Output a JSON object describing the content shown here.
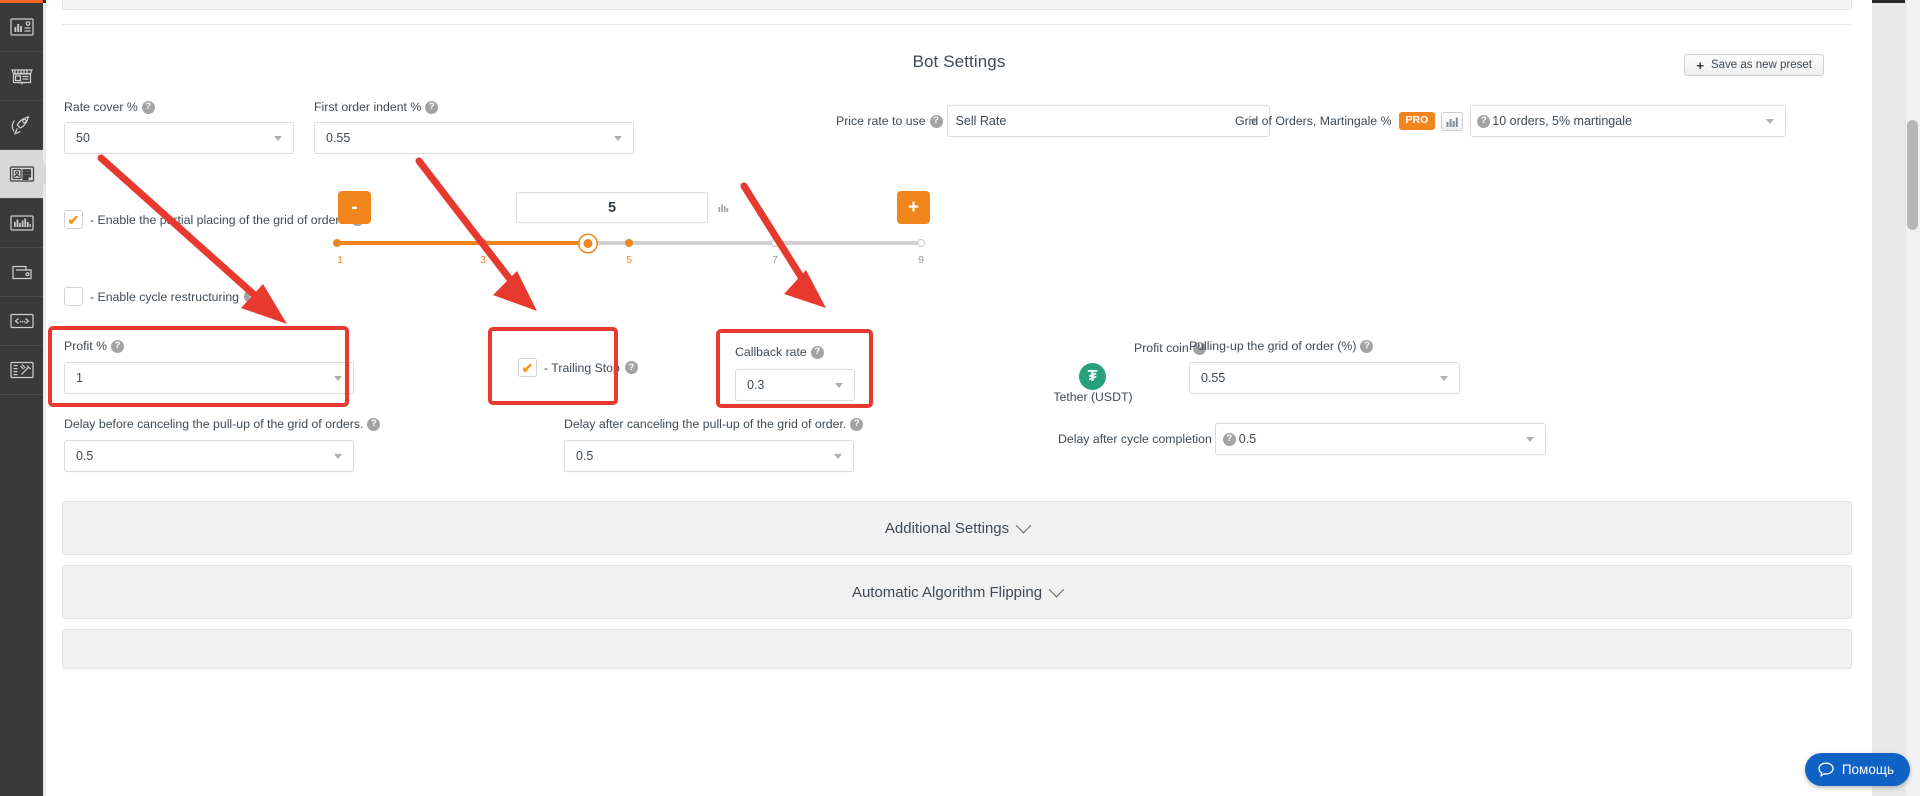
{
  "sidebar": {
    "items": [
      {
        "name": "dashboard",
        "icon": "chart-report-icon",
        "active": false
      },
      {
        "name": "marketplace",
        "icon": "storefront-icon",
        "active": false
      },
      {
        "name": "launch",
        "icon": "rocket-icon",
        "active": false
      },
      {
        "name": "bots",
        "icon": "id-card-icon",
        "active": true
      },
      {
        "name": "statistics",
        "icon": "bar-chart-icon",
        "active": false
      },
      {
        "name": "wallet",
        "icon": "wallet-icon",
        "active": false
      },
      {
        "name": "api",
        "icon": "code-brackets-icon",
        "active": false
      },
      {
        "name": "tools",
        "icon": "list-tools-icon",
        "active": false
      }
    ]
  },
  "header": {
    "title": "Bot Settings",
    "save_preset_label": "Save as new preset",
    "save_preset_plus": "+"
  },
  "fields": {
    "rate_cover": {
      "label": "Rate cover %",
      "value": "50",
      "help": "?"
    },
    "first_order_indent": {
      "label": "First order indent %",
      "value": "0.55",
      "help": "?"
    },
    "price_rate_to_use": {
      "label": "Price rate to use",
      "value": "Sell Rate",
      "help": "?"
    },
    "grid_martingale": {
      "label": "Grid of Orders, Martingale %",
      "badge": "PRO",
      "chart_icon": "bar-chart-icon",
      "help": "?",
      "value": "10 orders, 5% martingale"
    },
    "profit_pct": {
      "label": "Profit %",
      "value": "1",
      "help": "?"
    },
    "callback_rate": {
      "label": "Callback rate",
      "value": "0.3",
      "help": "?"
    },
    "profit_coin": {
      "label": "Profit coin",
      "help": "?",
      "coin_symbol": "₮",
      "coin_name": "Tether (USDT)"
    },
    "pulling_up_grid": {
      "label": "Pulling-up the grid of order (%)",
      "value": "0.55",
      "help": "?"
    },
    "delay_before_cancel": {
      "label": "Delay before canceling the pull-up of the grid of orders.",
      "value": "0.5",
      "help": "?"
    },
    "delay_after_cancel": {
      "label": "Delay after canceling the pull-up of the grid of order.",
      "value": "0.5",
      "help": "?"
    },
    "delay_after_cycle": {
      "label": "Delay after cycle completion",
      "value": "0.5",
      "help": "?"
    }
  },
  "checkboxes": {
    "partial_placing": {
      "label": "- Enable the partial placing of the grid of orders",
      "checked": true,
      "tick": "✔",
      "help": "?"
    },
    "cycle_restructuring": {
      "label": "- Enable cycle restructuring",
      "checked": false,
      "tick": "",
      "help": "?"
    },
    "trailing_stop": {
      "label": "- Trailing Stop",
      "checked": true,
      "tick": "✔",
      "help": "?"
    }
  },
  "slider": {
    "minus_label": "-",
    "plus_label": "+",
    "value": "5",
    "min": 1,
    "max": 9,
    "ticks": [
      {
        "label": "1",
        "pos": 0,
        "filled": true
      },
      {
        "label": "3",
        "pos": 25,
        "filled": true
      },
      {
        "label": "5",
        "pos": 50,
        "filled": true
      },
      {
        "label": "7",
        "pos": 75,
        "filled": false
      },
      {
        "label": "9",
        "pos": 100,
        "filled": false
      }
    ],
    "chart_icon": "mini-bar-chart-icon"
  },
  "accordions": [
    {
      "label": "Additional Settings",
      "expanded": false
    },
    {
      "label": "Automatic Algorithm Flipping",
      "expanded": false
    }
  ],
  "help_widget": {
    "label": "Помощь",
    "icon": "chat-bubble-icon"
  },
  "colors": {
    "accent_orange": "#f0861b",
    "annotation_red": "#e8392e",
    "help_blue": "#1062c4",
    "tether_green": "#26a17b",
    "pro_badge": "#f0861b",
    "sidebar_bg": "#3a3a3a"
  }
}
